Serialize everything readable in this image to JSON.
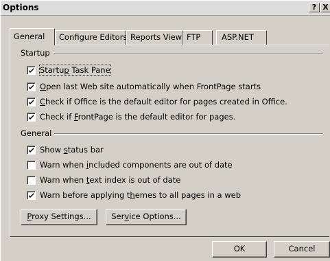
{
  "window": {
    "title": "Options",
    "help_glyph": "?",
    "close_glyph": "X"
  },
  "tabs": [
    {
      "label": "General",
      "active": true
    },
    {
      "label": "Configure Editors",
      "active": false
    },
    {
      "label": "Reports View",
      "active": false
    },
    {
      "label": "FTP",
      "active": false
    },
    {
      "label": "ASP.NET",
      "active": false
    }
  ],
  "startup": {
    "group_label": "Startup",
    "items": [
      {
        "pre": "Startu",
        "key": "p",
        "post": " Task Pane",
        "checked": true
      },
      {
        "pre": "",
        "key": "O",
        "post": "pen last Web site automatically when FrontPage starts",
        "checked": true
      },
      {
        "pre": "",
        "key": "C",
        "post": "heck if Office is the default editor for pages created in Office.",
        "checked": true
      },
      {
        "pre": "Check if ",
        "key": "F",
        "post": "rontPage is the default editor for pages.",
        "checked": true
      }
    ]
  },
  "general": {
    "group_label": "General",
    "items": [
      {
        "pre": "Show ",
        "key": "s",
        "post": "tatus bar",
        "checked": true
      },
      {
        "pre": "Warn when ",
        "key": "i",
        "post": "ncluded components are out of date",
        "checked": false
      },
      {
        "pre": "Warn when ",
        "key": "t",
        "post": "ext index is out of date",
        "checked": false
      },
      {
        "pre": "Warn before applying t",
        "key": "h",
        "post": "emes to all pages in a web",
        "checked": true
      }
    ]
  },
  "buttons": {
    "proxy": {
      "pre": "",
      "key": "P",
      "post": "roxy Settings..."
    },
    "service": {
      "pre": "Ser",
      "key": "v",
      "post": "ice Options..."
    },
    "ok": "OK",
    "cancel": "Cancel"
  }
}
